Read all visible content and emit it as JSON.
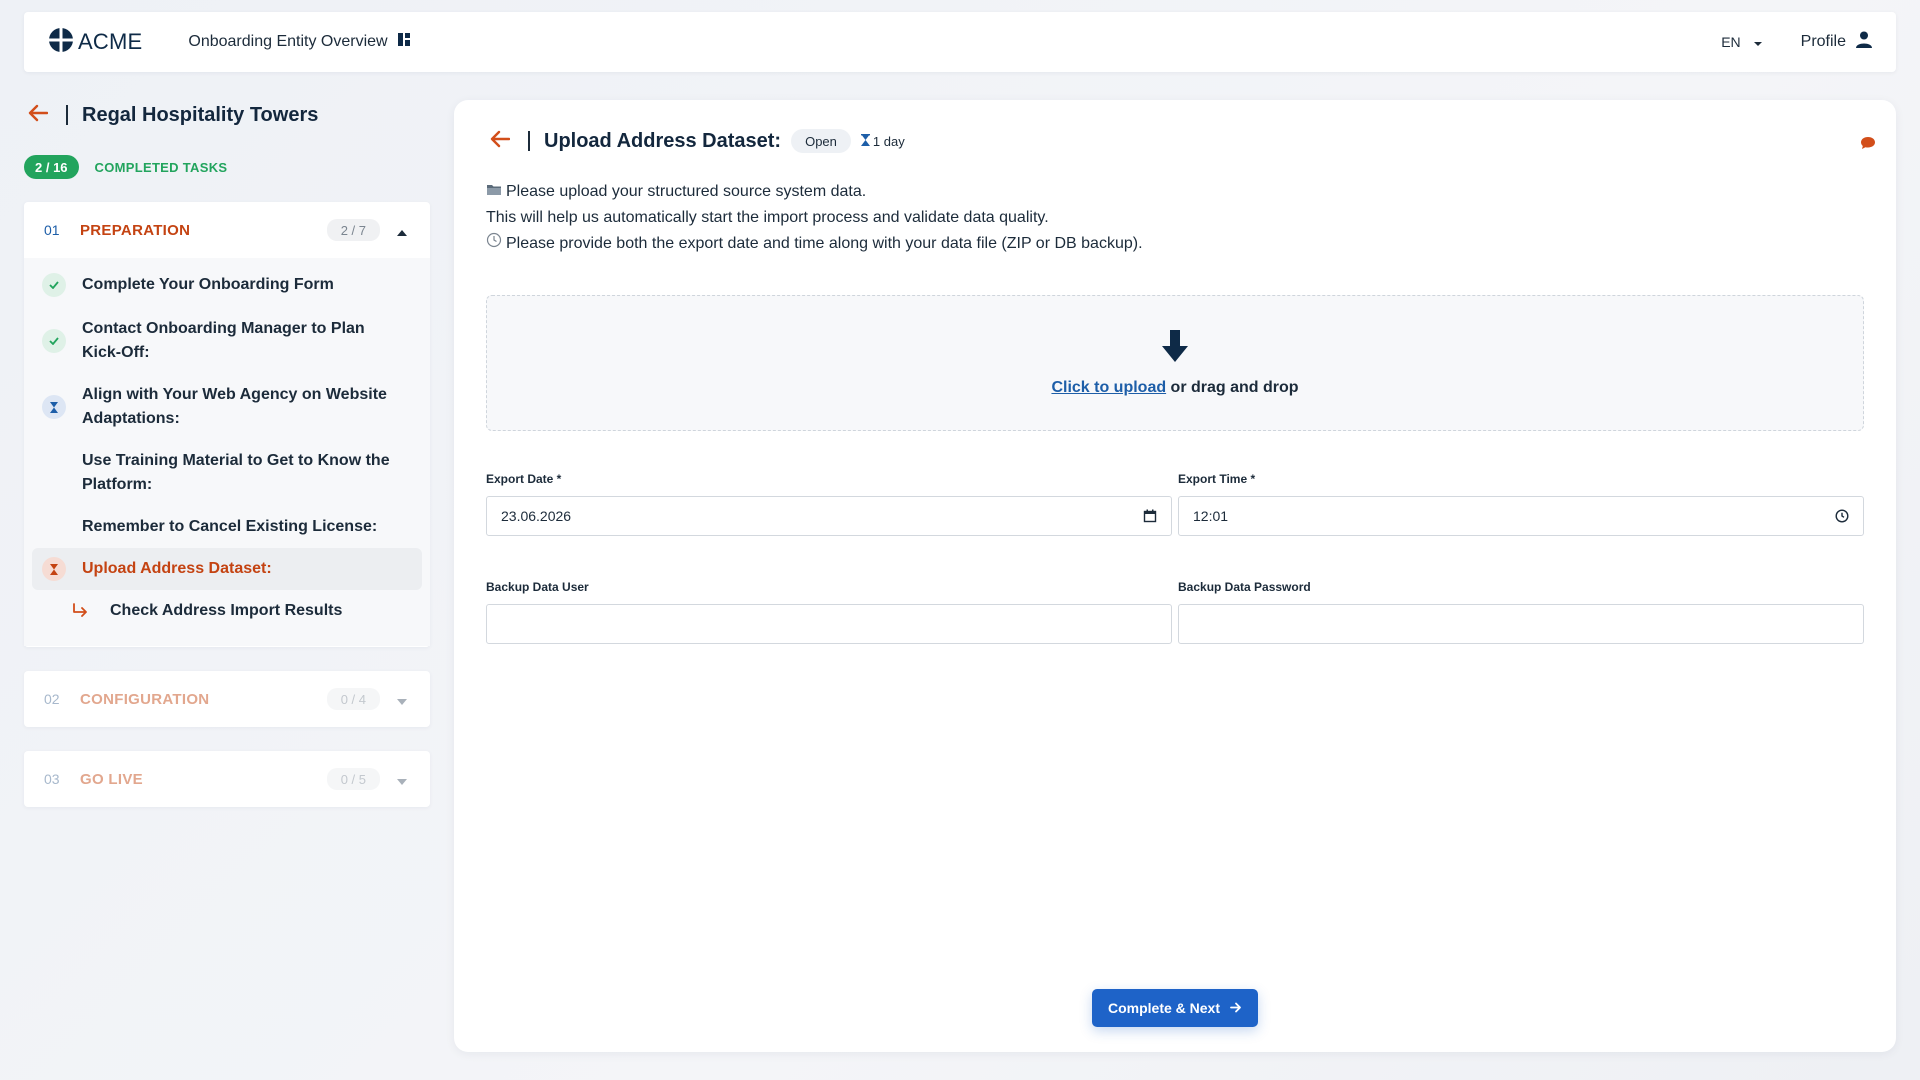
{
  "header": {
    "logo_text": "ACME",
    "nav_title": "Onboarding Entity Overview",
    "language": "EN",
    "profile_label": "Profile"
  },
  "sidebar": {
    "entity_name": "Regal Hospitality Towers",
    "progress_badge": "2 / 16",
    "progress_label": "COMPLETED TASKS",
    "sections": [
      {
        "number": "01",
        "title": "PREPARATION",
        "count": "2 / 7",
        "expanded": true,
        "tasks": [
          {
            "label": "Complete Your Onboarding Form",
            "status": "done"
          },
          {
            "label": "Contact Onboarding Manager to Plan Kick-Off:",
            "status": "done"
          },
          {
            "label": "Align with Your Web Agency on Website Adaptations:",
            "status": "waiting"
          },
          {
            "label": "Use Training Material to Get to Know the Platform:",
            "status": "none"
          },
          {
            "label": "Remember to Cancel Existing License:",
            "status": "none"
          },
          {
            "label": "Upload Address Dataset:",
            "status": "active"
          },
          {
            "label": "Check Address Import Results",
            "status": "subtask"
          }
        ]
      },
      {
        "number": "02",
        "title": "CONFIGURATION",
        "count": "0 / 4",
        "expanded": false
      },
      {
        "number": "03",
        "title": "GO LIVE",
        "count": "0 / 5",
        "expanded": false
      }
    ]
  },
  "main": {
    "title": "Upload Address Dataset:",
    "status": "Open",
    "due": "1 day",
    "description": [
      "Please upload your structured source system data.",
      "This will help us automatically start the import process and validate data quality.",
      "Please provide both the export date and time along with your data file (ZIP or DB backup)."
    ],
    "upload": {
      "link_text": "Click to upload",
      "rest_text": " or drag and drop"
    },
    "fields": {
      "export_date_label": "Export Date *",
      "export_date_value": "23.06.2026",
      "export_time_label": "Export Time *",
      "export_time_value": "12:01",
      "backup_user_label": "Backup Data User",
      "backup_user_value": "",
      "backup_password_label": "Backup Data Password",
      "backup_password_value": ""
    },
    "cta_label": "Complete & Next"
  },
  "colors": {
    "accent_orange": "#c44312",
    "primary_blue": "#1e63c8",
    "success_green": "#22a45d",
    "navy": "#0e2a47"
  }
}
